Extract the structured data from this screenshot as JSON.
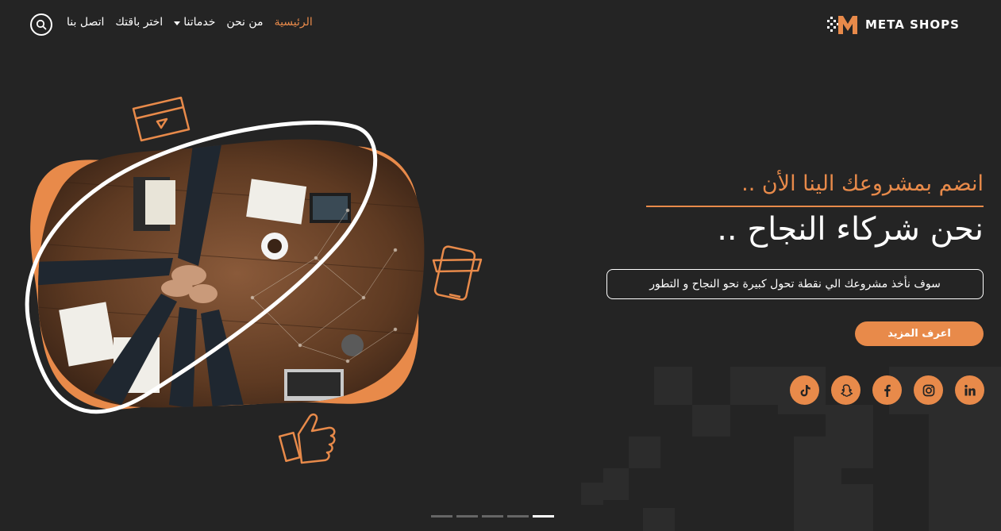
{
  "brand": {
    "name": "META SHOPS",
    "accent_color": "#e88a4a",
    "background_color": "#242424"
  },
  "nav": {
    "items": [
      {
        "label": "الرئيسية",
        "active": true
      },
      {
        "label": "من نحن",
        "active": false
      },
      {
        "label": "خدماتنا",
        "active": false,
        "dropdown": true
      },
      {
        "label": "اختر باقتك",
        "active": false
      },
      {
        "label": "اتصل بنا",
        "active": false
      }
    ],
    "search_icon": "search-icon"
  },
  "hero": {
    "tagline": "انضم بمشروعك الينا الأن ..",
    "headline": "نحن شركاء النجاح ..",
    "description": "سوف نأخذ مشروعك الي نقطة تحول كبيرة نحو النجاح و التطور",
    "cta_label": "اعرف المزيد"
  },
  "socials": [
    {
      "icon": "tiktok-icon"
    },
    {
      "icon": "snapchat-icon"
    },
    {
      "icon": "facebook-icon"
    },
    {
      "icon": "instagram-icon"
    },
    {
      "icon": "linkedin-icon"
    }
  ],
  "slider": {
    "slide_count": 5,
    "active_index": 4
  }
}
